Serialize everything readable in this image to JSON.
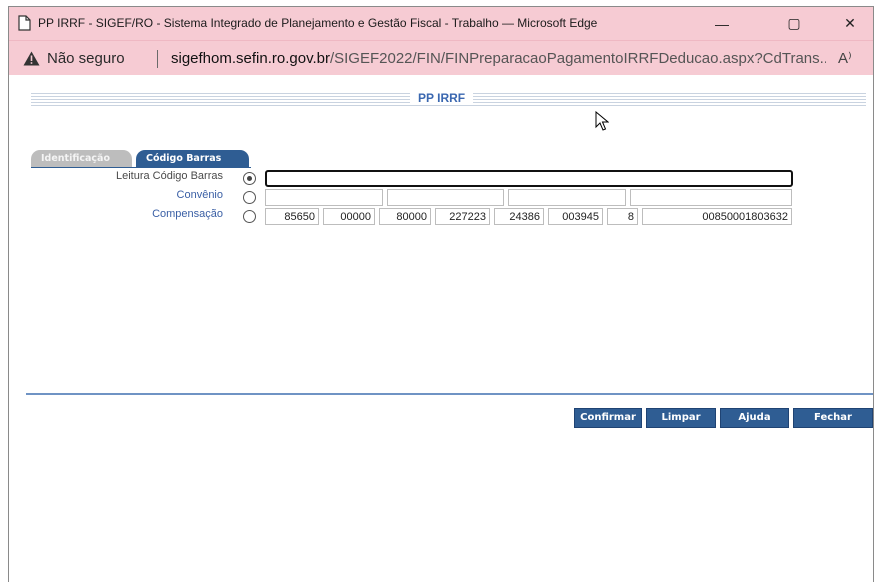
{
  "window": {
    "title": "PP IRRF - SIGEF/RO - Sistema Integrado de Planejamento e Gestão Fiscal - Trabalho — Microsoft Edge",
    "minimize": "—",
    "maximize": "▢",
    "close": "✕"
  },
  "address": {
    "security_label": "Não seguro",
    "url_host": "sigefhom.sefin.ro.gov.br",
    "url_path": "/SIGEF2022/FIN/FINPreparacaoPagamentoIRRFDeducao.aspx?CdTrans...",
    "read_aloud": "A⁾"
  },
  "page": {
    "header_title": "PP IRRF",
    "tabs": [
      {
        "label": "Identificação",
        "active": false
      },
      {
        "label": "Código Barras",
        "active": true
      }
    ],
    "rows": {
      "leitura_label": "Leitura Código Barras",
      "convenio_label": "Convênio",
      "compensacao_label": "Compensação"
    },
    "leitura_value": "",
    "convenio_fields": [
      "",
      "",
      "",
      ""
    ],
    "compensacao_fields": [
      "85650",
      "00000",
      "80000",
      "227223",
      "24386",
      "003945",
      "8",
      "00850001803632"
    ],
    "selected_option": "Leitura Código Barras"
  },
  "buttons": {
    "confirmar": "Confirmar",
    "limpar": "Limpar",
    "ajuda": "Ajuda",
    "fechar": "Fechar"
  },
  "colors": {
    "titlebar": "#f6cbd3",
    "accent": "#2f5d93",
    "label_blue": "#3a5fa5"
  }
}
